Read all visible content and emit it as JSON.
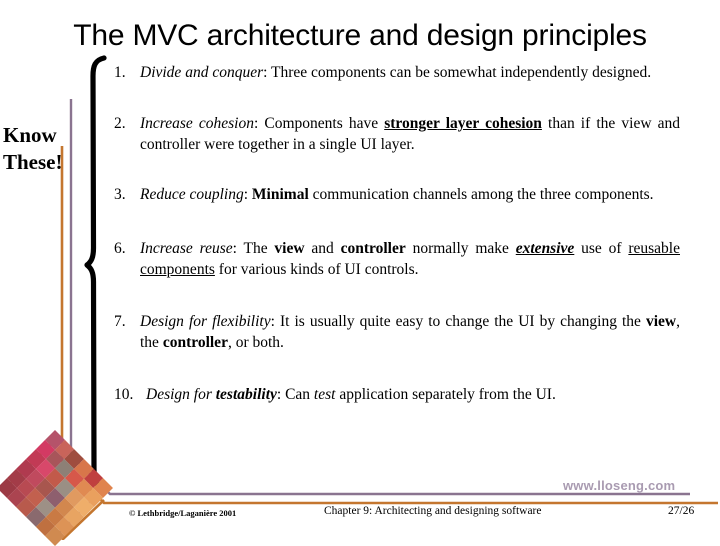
{
  "slide": {
    "title": "The MVC architecture and design principles",
    "callout": {
      "line1": "Know",
      "line2": "These!"
    },
    "watermark": "www.lloseng.com"
  },
  "colors": {
    "purple_line": "#8a7490",
    "orange_line": "#c4762f",
    "brace": "#000000",
    "text": "#000000",
    "watermark": "#9b8aa4"
  },
  "items": [
    {
      "number": "1.",
      "italic_lead": "Divide and conquer",
      "rest_line1": ": Three components can be somewhat",
      "line2": "independently designed."
    },
    {
      "number": "2.",
      "italic_lead": "Increase cohesion",
      "rest_a": ": Components have ",
      "emph": "stronger layer cohesion",
      "rest_b": " than",
      "line2": "if the view and controller were together in a single UI layer."
    },
    {
      "number": "3.",
      "italic_lead": "Reduce coupling",
      "rest_a": ": ",
      "emph": "Minimal",
      "rest_b": " communication channels among the",
      "line2": "three components."
    },
    {
      "number": "6.",
      "italic_lead": "Increase reuse",
      "rest_a": ": The ",
      "bold1": "view",
      "rest_b": " and ",
      "bold2": "controller",
      "rest_c": " normally make ",
      "emph": "extensive",
      "line2_a": "use of ",
      "line2_emph": "reusable components",
      "line2_b": " for various kinds of UI controls."
    },
    {
      "number": "7.",
      "italic_lead": "Design for flexibility",
      "rest_a": ": It is usually quite easy to change the UI by",
      "line2_a": "changing the ",
      "line2_bold1": "view",
      "line2_b": ", the ",
      "line2_bold2": "controller",
      "line2_c": ", or both."
    },
    {
      "number": "10.",
      "italic_lead": "Design for ",
      "bolditalic_lead": "testability",
      "rest_a": ": Can ",
      "italic_mid": "test",
      "rest_b": " application separately from the UI."
    }
  ],
  "footer": {
    "copyright": "© Lethbridge/Laganière 2001",
    "chapter": "Chapter 9: Architecting and designing software",
    "page": "27/26"
  },
  "quilt": {
    "rows": [
      [
        "#b5536a",
        "#c9645a",
        "#9f4d3f",
        "#d8764a",
        "#c0403f",
        "#e0844e"
      ],
      [
        "#d33a63",
        "#a8555a",
        "#8d8076",
        "#d6584a",
        "#e08a52",
        "#eaa05e"
      ],
      [
        "#c23a55",
        "#d8486a",
        "#c25a4a",
        "#9a8f84",
        "#e09a60",
        "#efae6a"
      ],
      [
        "#b03a4f",
        "#c04a5e",
        "#a8564e",
        "#8e5f6e",
        "#d2874e",
        "#e8a462"
      ],
      [
        "#a33c48",
        "#b84a52",
        "#c2604e",
        "#9d9086",
        "#c97a44",
        "#dd9356"
      ],
      [
        "#9c3a45",
        "#ab4450",
        "#b85a4c",
        "#8a6a6e",
        "#bf7040",
        "#d08a50"
      ]
    ]
  }
}
